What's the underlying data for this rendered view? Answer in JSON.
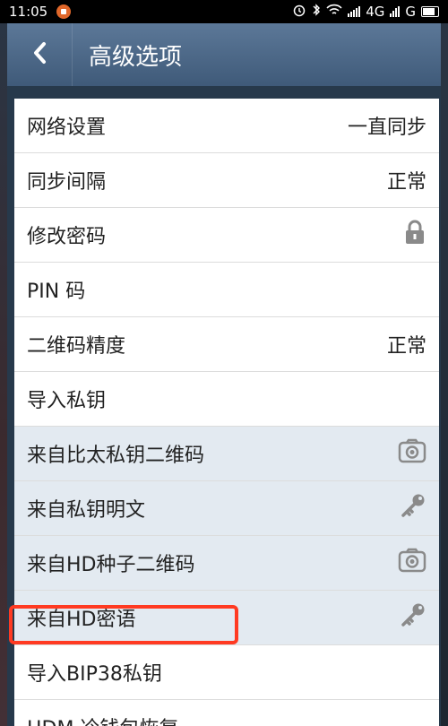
{
  "status_bar": {
    "time": "11:05",
    "network": "4G",
    "network2": "G"
  },
  "header": {
    "title": "高级选项",
    "back_icon": "chevron-left-icon"
  },
  "rows": [
    {
      "label": "网络设置",
      "value": "一直同步"
    },
    {
      "label": "同步间隔",
      "value": "正常"
    },
    {
      "label": "修改密码",
      "icon": "lock-icon"
    },
    {
      "label": "PIN 码"
    },
    {
      "label": "二维码精度",
      "value": "正常"
    },
    {
      "label": "导入私钥"
    },
    {
      "label": "来自比太私钥二维码",
      "icon": "camera-icon"
    },
    {
      "label": "来自私钥明文",
      "icon": "key-icon"
    },
    {
      "label": "来自HD种子二维码",
      "icon": "camera-icon"
    },
    {
      "label": "来自HD密语",
      "icon": "key-icon"
    },
    {
      "label": "导入BIP38私钥"
    },
    {
      "label": "HDM 冷钱包恢复"
    }
  ],
  "colors": {
    "header": "#4e6a8a",
    "subrow": "#e3eaf1",
    "highlight": "#ff3a22"
  }
}
